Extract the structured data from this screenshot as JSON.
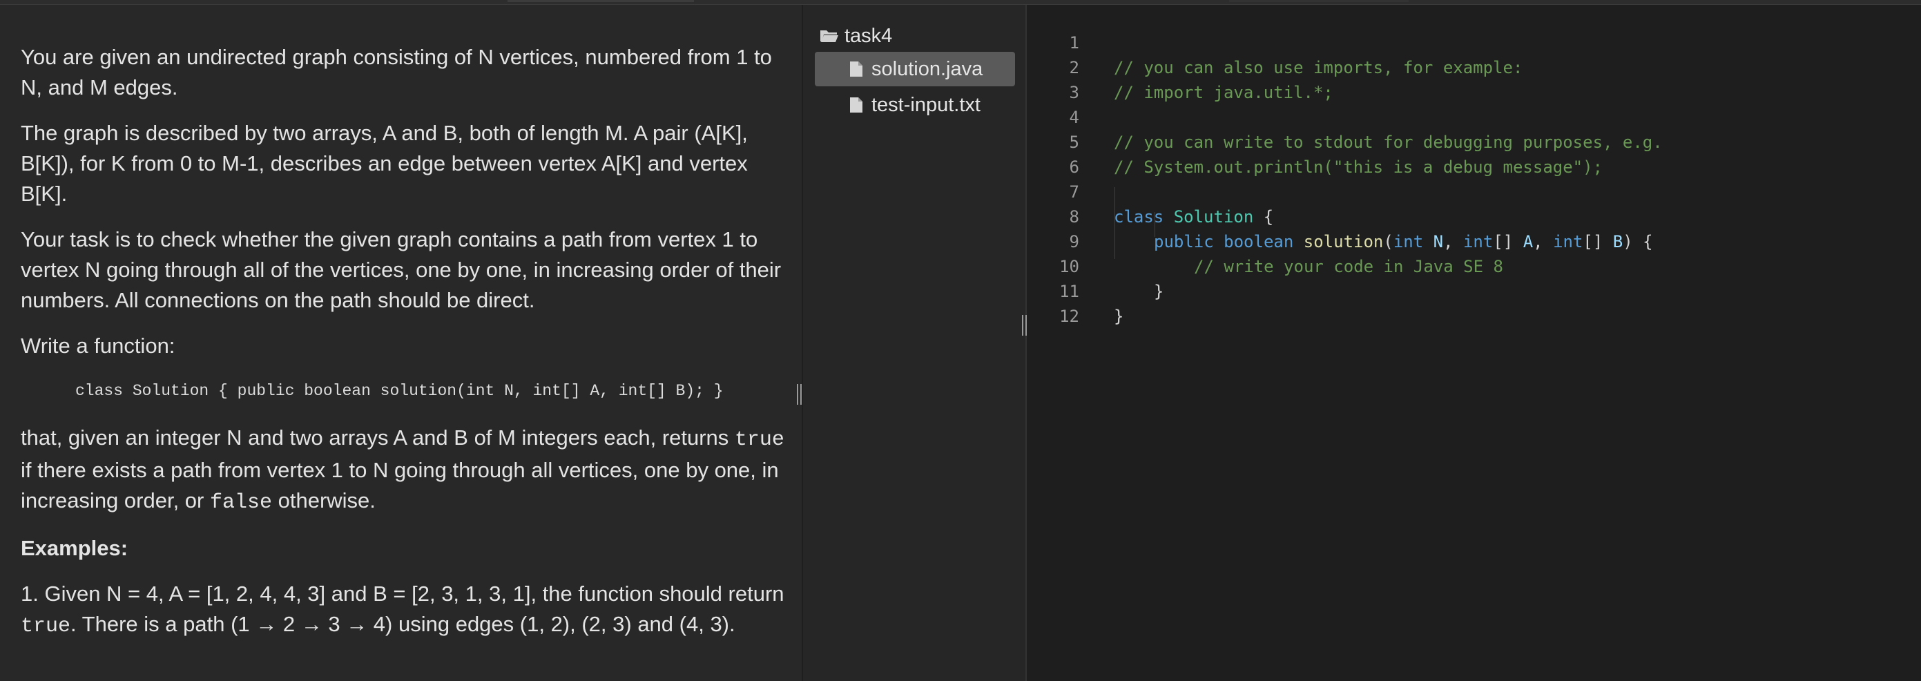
{
  "task": {
    "p1": "You are given an undirected graph consisting of N vertices, numbered from 1 to N, and M edges.",
    "p2": "The graph is described by two arrays, A and B, both of length M. A pair (A[K], B[K]), for K from 0 to M-1, describes an edge between vertex A[K] and vertex B[K].",
    "p3": "Your task is to check whether the given graph contains a path from vertex 1 to vertex N going through all of the vertices, one by one, in increasing order of their numbers. All connections on the path should be direct.",
    "p4": "Write a function:",
    "code_signature": "class Solution { public boolean solution(int N, int[] A, int[] B); }",
    "p5_a": "that, given an integer N and two arrays A and B of M integers each, returns ",
    "p5_true": "true",
    "p5_b": " if there exists a path from vertex 1 to N going through all vertices, one by one, in increasing order, or ",
    "p5_false": "false",
    "p5_c": " otherwise.",
    "examples_heading": "Examples:",
    "ex1_a": "1. Given N = 4, A = [1, 2, 4, 4, 3] and B = [2, 3, 1, 3, 1], the function should return ",
    "ex1_true": "true",
    "ex1_b": ". There is a path (1 → 2 → 3 → 4) using edges (1, 2), (2, 3) and (4, 3)."
  },
  "file_tree": {
    "folder": "task4",
    "files": [
      "solution.java",
      "test-input.txt"
    ],
    "selected": "solution.java"
  },
  "editor": {
    "line_numbers": [
      "1",
      "2",
      "3",
      "4",
      "5",
      "6",
      "7",
      "8",
      "9",
      "10",
      "11",
      "12"
    ],
    "line1": "// you can also use imports, for example:",
    "line2": "// import java.util.*;",
    "line4": "// you can write to stdout for debugging purposes, e.g.",
    "line5": "// System.out.println(\"this is a debug message\");",
    "line7_kw": "class",
    "line7_name": "Solution",
    "line7_brace": " {",
    "line8_public": "public",
    "line8_boolean": "boolean",
    "line8_fn": "solution",
    "line8_int1": "int",
    "line8_N": "N",
    "line8_int2": "int",
    "line8_A": "A",
    "line8_int3": "int",
    "line8_B": "B",
    "line9": "// write your code in Java SE 8",
    "line10": "}",
    "line11": "}"
  },
  "colors": {
    "comment": "#6a9955",
    "keyword": "#569cd6",
    "type": "#4ec9b0",
    "function": "#dcdcaa",
    "param": "#9cdcfe"
  }
}
